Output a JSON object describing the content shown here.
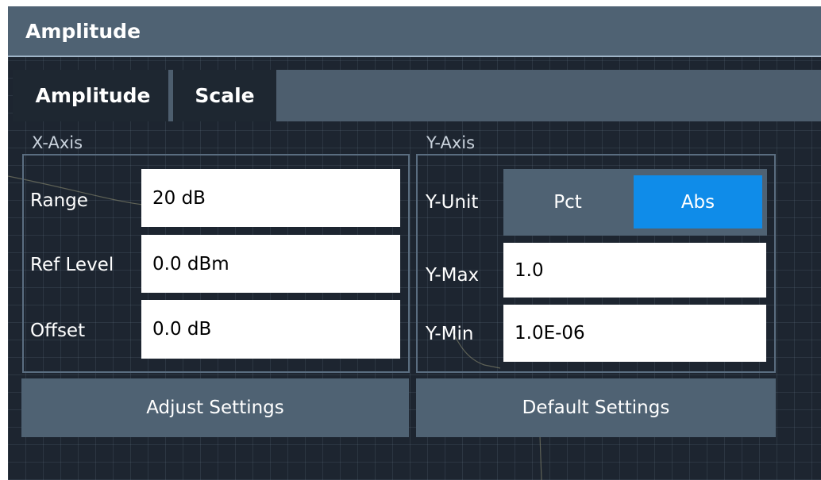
{
  "dialog": {
    "title": "Amplitude"
  },
  "tabs": [
    {
      "label": "Amplitude",
      "selected": false
    },
    {
      "label": "Scale",
      "selected": true
    }
  ],
  "x_axis": {
    "label": "X-Axis",
    "range": {
      "label": "Range",
      "value": "20 dB"
    },
    "ref_level": {
      "label": "Ref Level",
      "value": "0.0 dBm"
    },
    "offset": {
      "label": "Offset",
      "value": "0.0 dB"
    }
  },
  "y_axis": {
    "label": "Y-Axis",
    "unit": {
      "label": "Y-Unit",
      "options": [
        "Pct",
        "Abs"
      ],
      "selected": "Abs"
    },
    "y_max": {
      "label": "Y-Max",
      "value": "1.0"
    },
    "y_min": {
      "label": "Y-Min",
      "value": "1.0E-06"
    }
  },
  "buttons": {
    "adjust": "Adjust Settings",
    "default": "Default Settings"
  },
  "colors": {
    "title_bar": "#4f6273",
    "background": "#1d2530",
    "accent": "#0f8ce9"
  }
}
